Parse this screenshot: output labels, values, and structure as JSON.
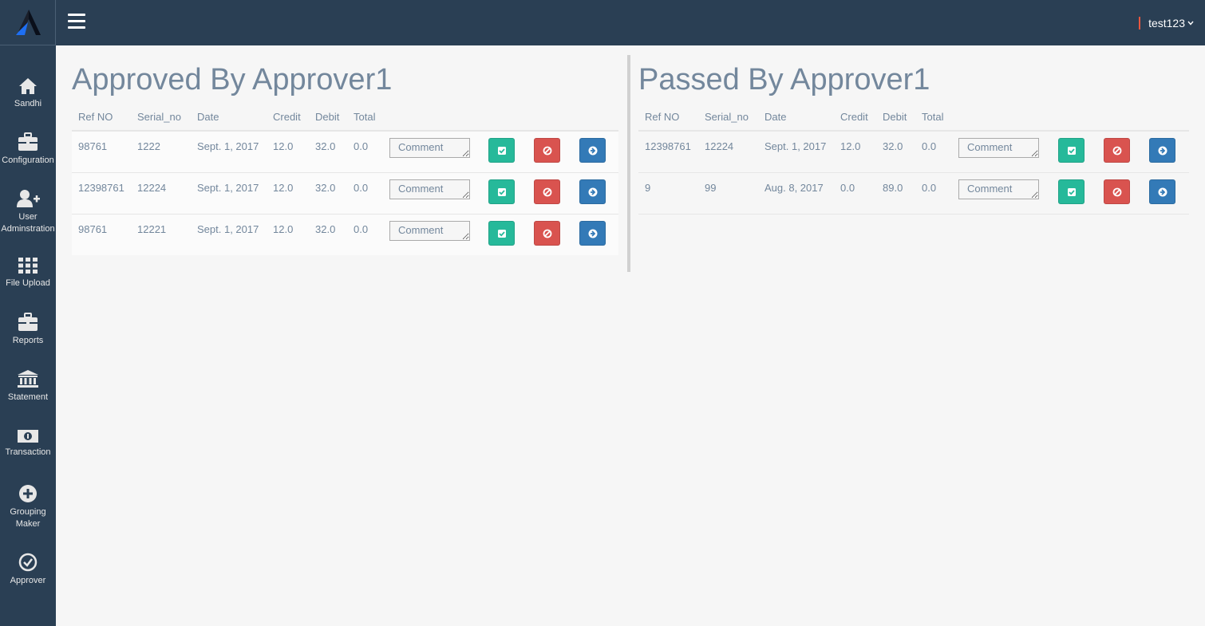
{
  "header": {
    "user_name": "test123",
    "accent": "#e9573f",
    "bg": "#2a3f54"
  },
  "sidebar": {
    "items": [
      {
        "label": "Sandhi",
        "icon": "home-icon"
      },
      {
        "label": "Configuration",
        "icon": "briefcase-icon"
      },
      {
        "label": "User Adminstration",
        "icon": "user-plus-icon"
      },
      {
        "label": "File Upload",
        "icon": "grid-icon"
      },
      {
        "label": "Reports",
        "icon": "briefcase-icon"
      },
      {
        "label": "Statement",
        "icon": "bank-icon"
      },
      {
        "label": "Transaction",
        "icon": "money-icon"
      },
      {
        "label": "Grouping Maker",
        "icon": "plus-circle-icon"
      },
      {
        "label": "Approver",
        "icon": "check-circle-icon"
      }
    ]
  },
  "approved": {
    "title": "Approved By Approver1",
    "columns": [
      "Ref NO",
      "Serial_no",
      "Date",
      "Credit",
      "Debit",
      "Total"
    ],
    "comment_placeholder": "Comment",
    "rows": [
      {
        "ref": "98761",
        "serial": "1222",
        "date": "Sept. 1, 2017",
        "credit": "12.0",
        "debit": "32.0",
        "total": "0.0"
      },
      {
        "ref": "12398761",
        "serial": "12224",
        "date": "Sept. 1, 2017",
        "credit": "12.0",
        "debit": "32.0",
        "total": "0.0"
      },
      {
        "ref": "98761",
        "serial": "12221",
        "date": "Sept. 1, 2017",
        "credit": "12.0",
        "debit": "32.0",
        "total": "0.0"
      }
    ]
  },
  "passed": {
    "title": "Passed By Approver1",
    "columns": [
      "Ref NO",
      "Serial_no",
      "Date",
      "Credit",
      "Debit",
      "Total"
    ],
    "comment_placeholder": "Comment",
    "rows": [
      {
        "ref": "12398761",
        "serial": "12224",
        "date": "Sept. 1, 2017",
        "credit": "12.0",
        "debit": "32.0",
        "total": "0.0"
      },
      {
        "ref": "9",
        "serial": "99",
        "date": "Aug. 8, 2017",
        "credit": "0.0",
        "debit": "89.0",
        "total": "0.0"
      }
    ]
  },
  "colors": {
    "approve": "#26b99a",
    "reject": "#d9534f",
    "forward": "#337ab7"
  }
}
